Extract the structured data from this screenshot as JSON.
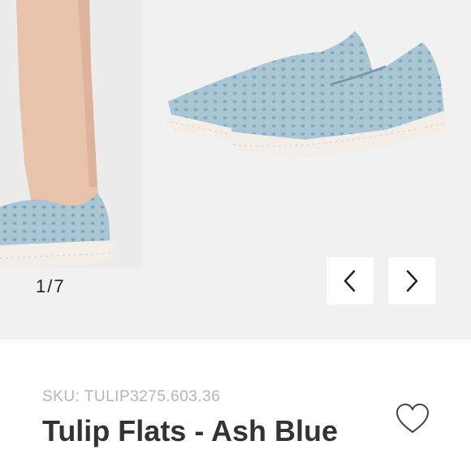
{
  "gallery": {
    "counter_current": "1",
    "counter_separator": "/",
    "counter_total": "7",
    "prev_icon": "chevron-left-icon",
    "next_icon": "chevron-right-icon"
  },
  "product": {
    "sku": "SKU: TULIP3275.603.36",
    "title": "Tulip Flats - Ash Blue",
    "favorite_icon": "heart-icon"
  },
  "colors": {
    "shoe": "#a9c6d6",
    "sole": "#f3efe8",
    "gallery_bg": "#f1f1f1",
    "sku_text": "#b5b5b5",
    "title_text": "#333333"
  }
}
